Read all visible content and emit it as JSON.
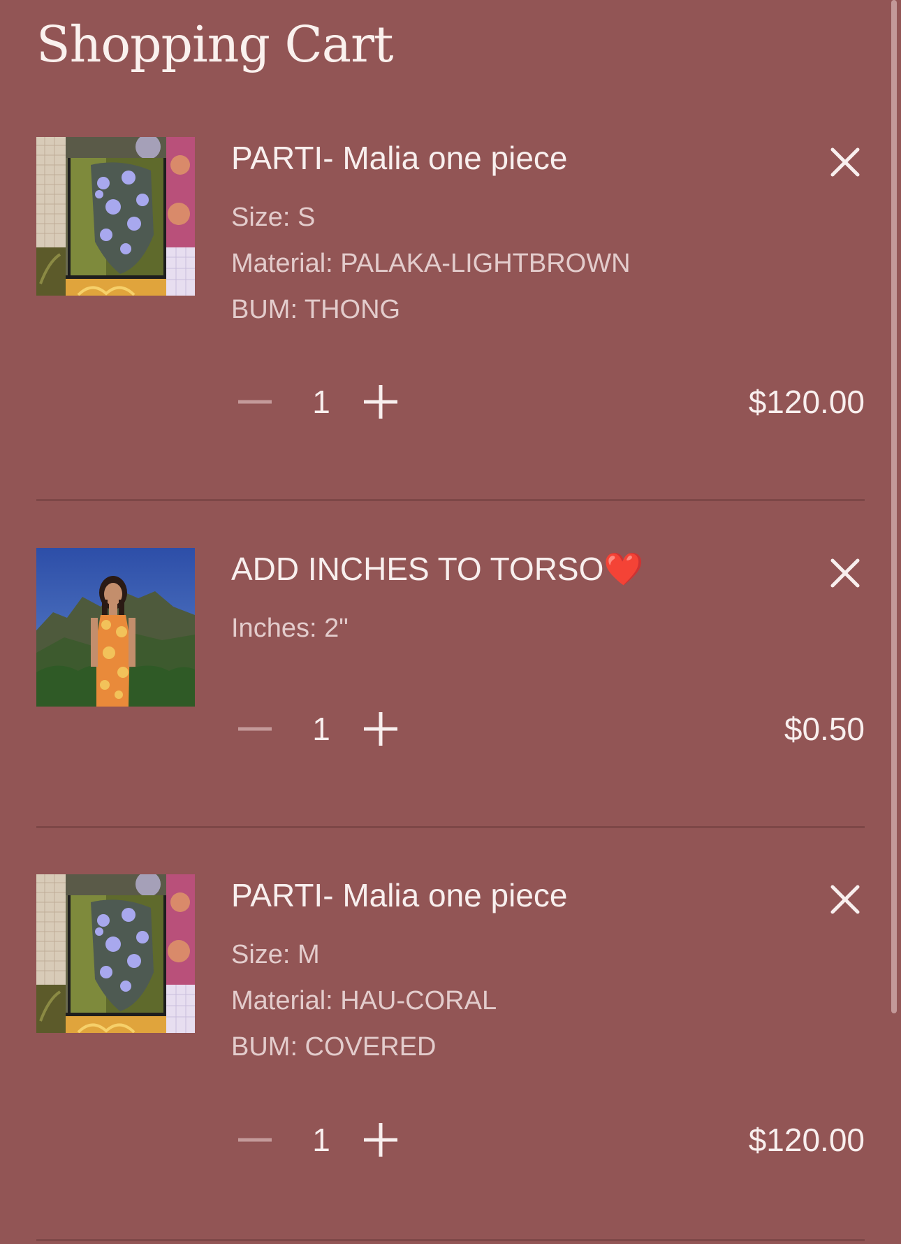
{
  "page": {
    "title": "Shopping Cart"
  },
  "cart": {
    "items": [
      {
        "title": "PARTI- Malia one piece",
        "options": [
          "Size: S",
          "Material: PALAKA-LIGHTBROWN",
          "BUM: THONG"
        ],
        "quantity": "1",
        "price": "$120.00",
        "image_alt": "Malia one piece swimsuit collage"
      },
      {
        "title": "ADD INCHES TO TORSO❤️",
        "options": [
          "Inches: 2\""
        ],
        "quantity": "1",
        "price": "$0.50",
        "image_alt": "Model in orange floral one piece in front of mountains"
      },
      {
        "title": "PARTI- Malia one piece",
        "options": [
          "Size: M",
          "Material: HAU-CORAL",
          "BUM: COVERED"
        ],
        "quantity": "1",
        "price": "$120.00",
        "image_alt": "Malia one piece swimsuit collage"
      }
    ]
  },
  "icons": {
    "remove": "close-icon",
    "decrease": "minus-icon",
    "increase": "plus-icon"
  },
  "colors": {
    "background": "#925555",
    "text": "#f8efee",
    "muted_text": "#e3cccc",
    "divider": "#7d4747"
  }
}
